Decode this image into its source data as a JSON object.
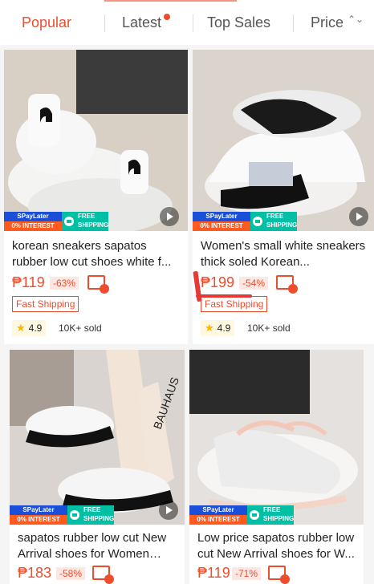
{
  "tabs": [
    {
      "label": "Popular",
      "active": true
    },
    {
      "label": "Latest",
      "active": false
    },
    {
      "label": "Top Sales",
      "active": false
    },
    {
      "label": "Price",
      "active": false
    }
  ],
  "sort_icon": "⌃⌄",
  "badge": {
    "spay": "SPayLater",
    "interest": "0% INTEREST",
    "free": "FREE",
    "shipping": "SHIPPING"
  },
  "products": [
    {
      "title": "korean sneakers sapatos rubber low cut shoes white f...",
      "price": "₱119",
      "discount": "-63%",
      "fast_shipping": "Fast Shipping",
      "rating": "4.9",
      "sold": "10K+ sold"
    },
    {
      "title": "Women's small white sneakers thick soled Korean...",
      "price": "₱199",
      "discount": "-54%",
      "fast_shipping": "Fast Shipping",
      "rating": "4.9",
      "sold": "10K+ sold"
    },
    {
      "title": "sapatos rubber low cut New Arrival shoes for Women Kor...",
      "price": "₱183",
      "discount": "-58%"
    },
    {
      "title": "Low price sapatos rubber low cut New Arrival shoes for W...",
      "price": "₱119",
      "discount": "-71%"
    }
  ]
}
